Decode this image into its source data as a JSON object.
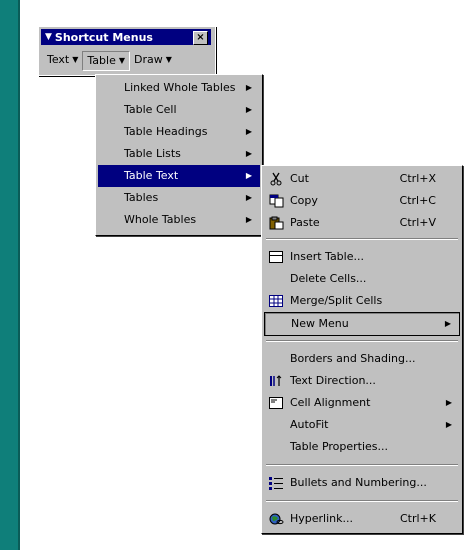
{
  "toolbar": {
    "title": "Shortcut Menus",
    "close": "×",
    "items": [
      {
        "label": "Text"
      },
      {
        "label": "Table"
      },
      {
        "label": "Draw"
      }
    ]
  },
  "menu1": {
    "items": [
      {
        "label": "Linked Whole Tables"
      },
      {
        "label": "Table Cell"
      },
      {
        "label": "Table Headings"
      },
      {
        "label": "Table Lists"
      },
      {
        "label": "Table Text"
      },
      {
        "label": "Tables"
      },
      {
        "label": "Whole Tables"
      }
    ]
  },
  "menu2": {
    "cut": "Cut",
    "cut_sc": "Ctrl+X",
    "copy": "Copy",
    "copy_sc": "Ctrl+C",
    "paste": "Paste",
    "paste_sc": "Ctrl+V",
    "insert_table": "Insert Table...",
    "delete_cells": "Delete Cells...",
    "merge_split": "Merge/Split Cells",
    "new_menu": "New Menu",
    "borders": "Borders and Shading...",
    "text_direction": "Text Direction...",
    "cell_alignment": "Cell Alignment",
    "autofit": "AutoFit",
    "table_properties": "Table Properties...",
    "bullets": "Bullets and Numbering...",
    "hyperlink": "Hyperlink...",
    "hyperlink_sc": "Ctrl+K"
  },
  "icons": [
    "cut-icon",
    "copy-icon",
    "paste-icon",
    "insert-table-icon",
    "merge-cells-icon",
    "text-direction-icon",
    "cell-alignment-icon",
    "bullets-icon",
    "hyperlink-icon"
  ],
  "colors": {
    "selection": "#000080",
    "menu": "#c0c0c0",
    "background": "#0f7f7a"
  }
}
